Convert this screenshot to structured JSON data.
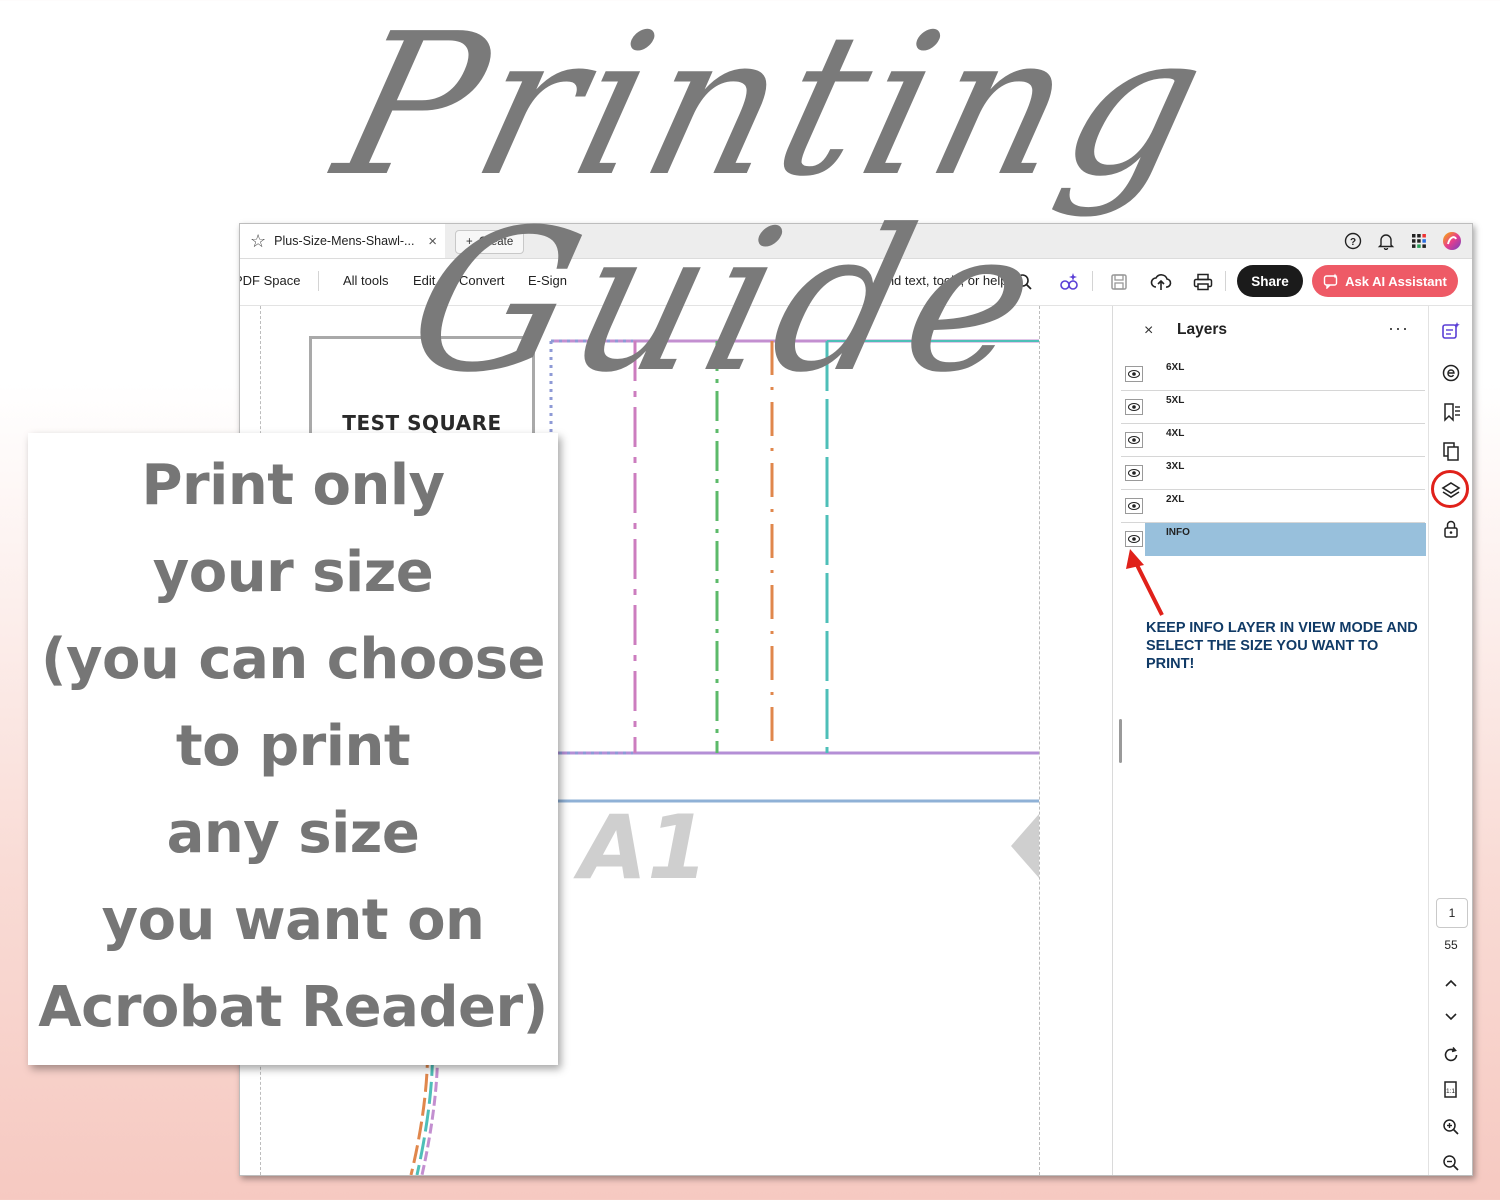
{
  "banner": {
    "title": "Printing Guide"
  },
  "tab": {
    "title": "Plus-Size-Mens-Shawl-...",
    "close": "×",
    "create_label": "Create"
  },
  "toolbar": {
    "space_label": "PDF Space",
    "all_tools": "All tools",
    "edit": "Edit",
    "convert": "Convert",
    "esign": "E-Sign",
    "find_text": "Find text, tools, or help",
    "share": "Share",
    "ai_assistant": "Ask AI Assistant"
  },
  "document": {
    "test_square": "TEST SQUARE",
    "page_label": "A1"
  },
  "layers_panel": {
    "close": "×",
    "title": "Layers",
    "more": "···",
    "layers": [
      "6XL",
      "5XL",
      "4XL",
      "3XL",
      "2XL",
      "INFO"
    ],
    "selected": "INFO",
    "instruction": "KEEP INFO LAYER IN VIEW MODE AND SELECT THE SIZE YOU WANT TO PRINT!"
  },
  "rail": {
    "current_page": "1",
    "total_pages": "55"
  },
  "card": {
    "lines": [
      "Print only",
      "your size",
      "(you can choose",
      "to print",
      "any size",
      "you want on",
      "Acrobat Reader)"
    ]
  },
  "colors": {
    "share_bg": "#1b1b1b",
    "ai_bg": "#ee5a66",
    "selected_layer": "#98c0dc",
    "annotation_red": "#e0211a",
    "instruction_text": "#103a66"
  }
}
